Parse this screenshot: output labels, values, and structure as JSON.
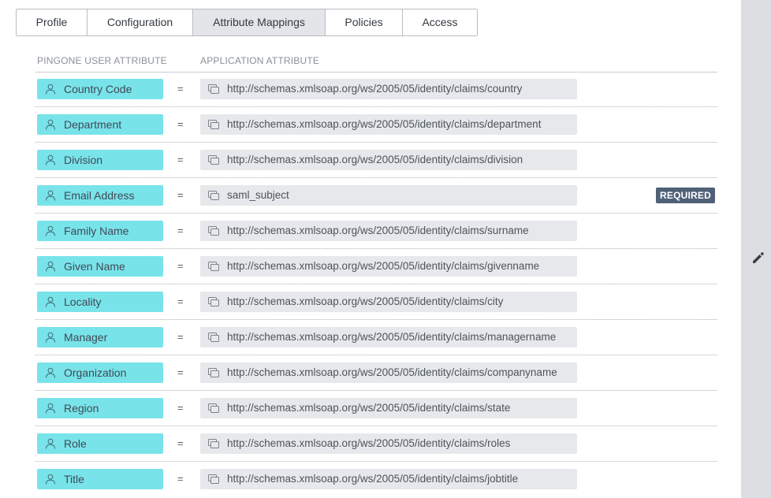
{
  "tabs": [
    {
      "label": "Profile",
      "active": false
    },
    {
      "label": "Configuration",
      "active": false
    },
    {
      "label": "Attribute Mappings",
      "active": true
    },
    {
      "label": "Policies",
      "active": false
    },
    {
      "label": "Access",
      "active": false
    }
  ],
  "columns": {
    "user_attribute": "PINGONE USER ATTRIBUTE",
    "application_attribute": "APPLICATION ATTRIBUTE"
  },
  "equals_sign": "=",
  "mappings": [
    {
      "user_attribute": "Country Code",
      "app_attribute": "http://schemas.xmlsoap.org/ws/2005/05/identity/claims/country",
      "badge": ""
    },
    {
      "user_attribute": "Department",
      "app_attribute": "http://schemas.xmlsoap.org/ws/2005/05/identity/claims/department",
      "badge": ""
    },
    {
      "user_attribute": "Division",
      "app_attribute": "http://schemas.xmlsoap.org/ws/2005/05/identity/claims/division",
      "badge": ""
    },
    {
      "user_attribute": "Email Address",
      "app_attribute": "saml_subject",
      "badge": "REQUIRED"
    },
    {
      "user_attribute": "Family Name",
      "app_attribute": "http://schemas.xmlsoap.org/ws/2005/05/identity/claims/surname",
      "badge": ""
    },
    {
      "user_attribute": "Given Name",
      "app_attribute": "http://schemas.xmlsoap.org/ws/2005/05/identity/claims/givenname",
      "badge": ""
    },
    {
      "user_attribute": "Locality",
      "app_attribute": "http://schemas.xmlsoap.org/ws/2005/05/identity/claims/city",
      "badge": ""
    },
    {
      "user_attribute": "Manager",
      "app_attribute": "http://schemas.xmlsoap.org/ws/2005/05/identity/claims/managername",
      "badge": ""
    },
    {
      "user_attribute": "Organization",
      "app_attribute": "http://schemas.xmlsoap.org/ws/2005/05/identity/claims/companyname",
      "badge": ""
    },
    {
      "user_attribute": "Region",
      "app_attribute": "http://schemas.xmlsoap.org/ws/2005/05/identity/claims/state",
      "badge": ""
    },
    {
      "user_attribute": "Role",
      "app_attribute": "http://schemas.xmlsoap.org/ws/2005/05/identity/claims/roles",
      "badge": ""
    },
    {
      "user_attribute": "Title",
      "app_attribute": "http://schemas.xmlsoap.org/ws/2005/05/identity/claims/jobtitle",
      "badge": ""
    }
  ],
  "icons": {
    "user_attribute_icon": "user-icon",
    "app_attribute_icon": "attribute-icon",
    "side_action_icon": "pencil-icon"
  },
  "colors": {
    "user_attribute_bg": "#79e3ea",
    "app_attribute_bg": "#e6e8eb",
    "badge_bg": "#4f6177",
    "active_tab_bg": "#e3e5e8",
    "side_panel_bg": "#dcdee2"
  }
}
